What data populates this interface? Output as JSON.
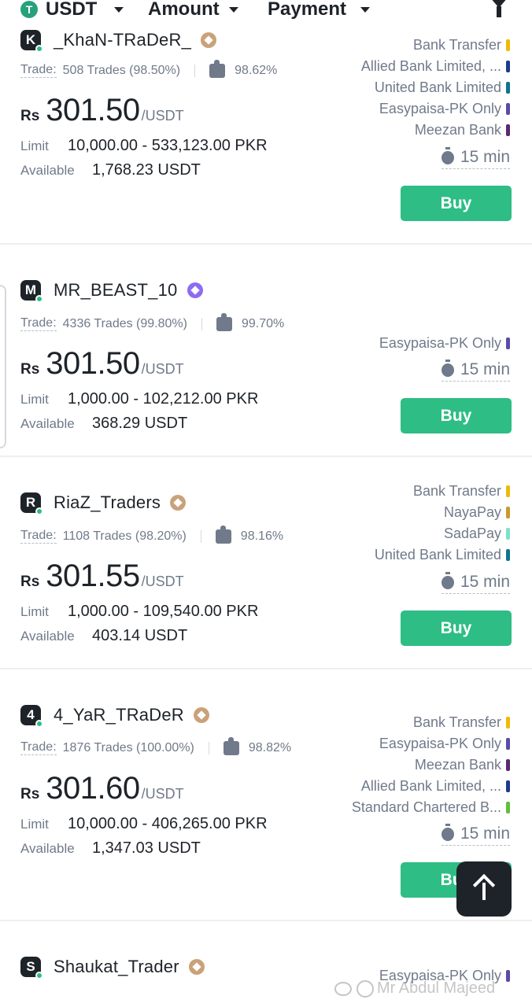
{
  "filters": {
    "coin": "USDT",
    "amount": "Amount",
    "payment": "Payment"
  },
  "price_currency": "Rs",
  "price_unit": "/USDT",
  "labels": {
    "trade": "Trade:",
    "limit": "Limit",
    "available": "Available",
    "buy": "Buy"
  },
  "listings": [
    {
      "name": "_KhaN-TRaDeR_",
      "avatar": "K",
      "trades": "508 Trades (98.50%)",
      "rating": "98.62%",
      "price": "301.50",
      "limit": "10,000.00 - 533,123.00 PKR",
      "available": "1,768.23 USDT",
      "time": "15 min",
      "payments": [
        {
          "name": "Bank Transfer",
          "color": "#f0b90b"
        },
        {
          "name": "Allied Bank Limited, ...",
          "color": "#1e3a8a"
        },
        {
          "name": "United Bank Limited",
          "color": "#0e7490"
        },
        {
          "name": "Easypaisa-PK Only",
          "color": "#5b4ba8"
        },
        {
          "name": "Meezan Bank",
          "color": "#5b2a6e"
        }
      ]
    },
    {
      "name": "MR_BEAST_10",
      "avatar": "M",
      "trades": "4336 Trades (99.80%)",
      "rating": "99.70%",
      "price": "301.50",
      "limit": "1,000.00 - 102,212.00 PKR",
      "available": "368.29 USDT",
      "time": "15 min",
      "payments": [
        {
          "name": "Easypaisa-PK Only",
          "color": "#5b4ba8"
        }
      ]
    },
    {
      "name": "RiaZ_Traders",
      "avatar": "R",
      "trades": "1108 Trades (98.20%)",
      "rating": "98.16%",
      "price": "301.55",
      "limit": "1,000.00 - 109,540.00 PKR",
      "available": "403.14 USDT",
      "time": "15 min",
      "payments": [
        {
          "name": "Bank Transfer",
          "color": "#f0b90b"
        },
        {
          "name": "NayaPay",
          "color": "#c99a2e"
        },
        {
          "name": "SadaPay",
          "color": "#7fe0c8"
        },
        {
          "name": "United Bank Limited",
          "color": "#0e7490"
        }
      ]
    },
    {
      "name": "4_YaR_TRaDeR",
      "avatar": "4",
      "trades": "1876 Trades (100.00%)",
      "rating": "98.82%",
      "price": "301.60",
      "limit": "10,000.00 - 406,265.00 PKR",
      "available": "1,347.03 USDT",
      "time": "15 min",
      "payments": [
        {
          "name": "Bank Transfer",
          "color": "#f0b90b"
        },
        {
          "name": "Easypaisa-PK Only",
          "color": "#5b4ba8"
        },
        {
          "name": "Meezan Bank",
          "color": "#5b2a6e"
        },
        {
          "name": "Allied Bank Limited, ...",
          "color": "#1e3a8a"
        },
        {
          "name": "Standard Chartered B...",
          "color": "#5fbf3a"
        }
      ]
    },
    {
      "name": "Shaukat_Trader",
      "avatar": "S",
      "payments": [
        {
          "name": "Easypaisa-PK Only",
          "color": "#5b4ba8"
        }
      ]
    }
  ],
  "watermark": "Mr Abdul Majeed"
}
